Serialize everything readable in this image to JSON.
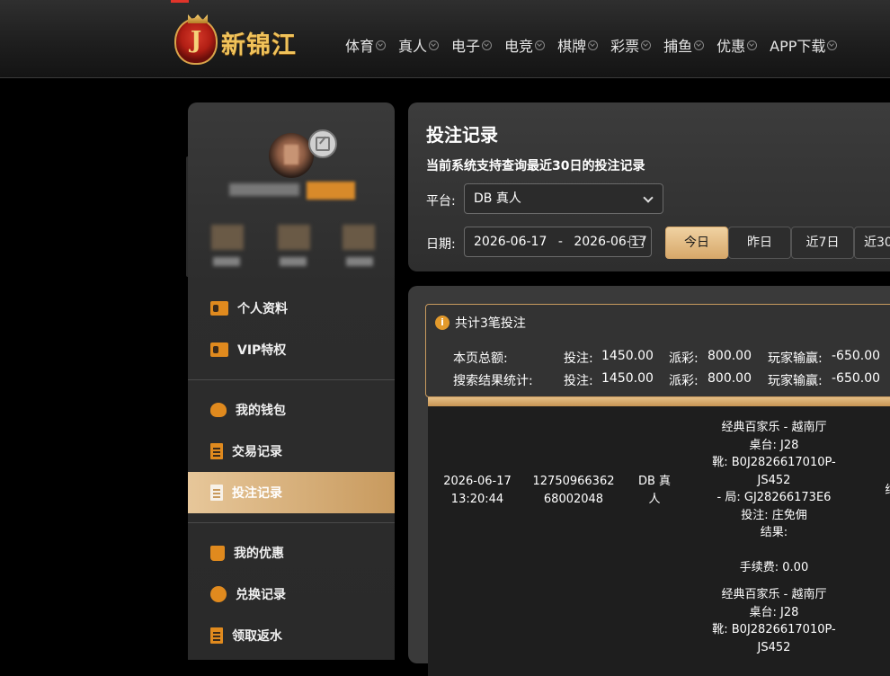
{
  "header": {
    "logo_letter": "J",
    "logo_text": "新锦江",
    "nav": [
      "体育",
      "真人",
      "电子",
      "电竞",
      "棋牌",
      "彩票",
      "捕鱼",
      "优惠",
      "APP下载"
    ]
  },
  "sidebar": {
    "menu": [
      {
        "label": "个人资料",
        "icon": "id-card-icon"
      },
      {
        "label": "VIP特权",
        "icon": "vip-card-icon"
      },
      {
        "label": "我的钱包",
        "icon": "piggy-bank-icon"
      },
      {
        "label": "交易记录",
        "icon": "transaction-doc-icon"
      },
      {
        "label": "投注记录",
        "icon": "bet-record-icon",
        "active": true
      },
      {
        "label": "我的优惠",
        "icon": "promo-bag-icon"
      },
      {
        "label": "兑换记录",
        "icon": "exchange-money-icon"
      },
      {
        "label": "领取返水",
        "icon": "rebate-doc-icon"
      }
    ]
  },
  "filter": {
    "title": "投注记录",
    "subtitle": "当前系统支持查询最近30日的投注记录",
    "platform_label": "平台:",
    "platform_value": "DB 真人",
    "date_label": "日期:",
    "date_from": "2026-06-17",
    "date_sep": "-",
    "date_to": "2026-06-17",
    "ranges": [
      "今日",
      "昨日",
      "近7日",
      "近30"
    ],
    "active_range": "今日"
  },
  "summary": {
    "total_text": "共计3笔投注",
    "page_label": "本页总额:",
    "search_label": "搜索结果统计:",
    "bet_label": "投注:",
    "payout_label": "派彩:",
    "winloss_label": "玩家输赢:",
    "page_bet": "1450.00",
    "page_payout": "800.00",
    "page_winloss": "-650.00",
    "search_bet": "1450.00",
    "search_payout": "800.00",
    "search_winloss": "-650.00"
  },
  "records": [
    {
      "date": "2026-06-17",
      "time": "13:20:44",
      "id_line1": "12750966362",
      "id_line2": "68002048",
      "platform_line1": "DB 真",
      "platform_line2": "人",
      "detail": [
        "经典百家乐 - 越南厅",
        "桌台: J28",
        "靴: B0J2826617010P-JS452",
        "- 局: GJ28266173E6",
        "投注: 庄免佣",
        "结果:",
        "",
        "手续费: 0.00"
      ],
      "status_partial": "结"
    },
    {
      "detail": [
        "经典百家乐 - 越南厅",
        "桌台: J28",
        "靴: B0J2826617010P-JS452"
      ]
    }
  ],
  "colors": {
    "accent": "#d7a86a",
    "orange_icon": "#e08a1e"
  }
}
